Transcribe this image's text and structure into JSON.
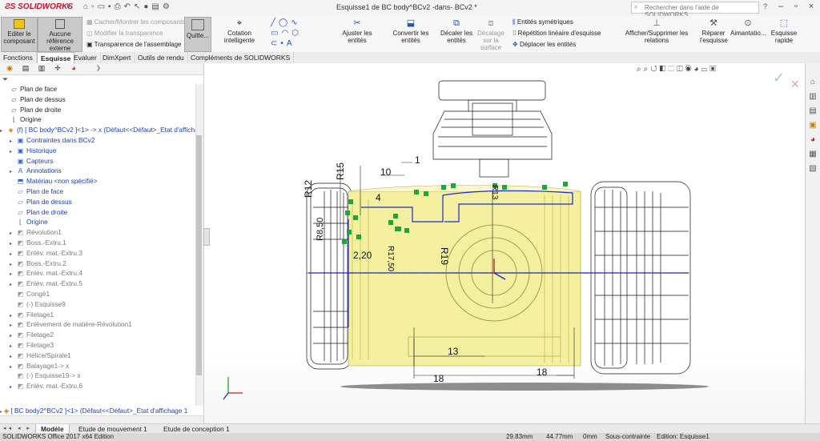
{
  "app": {
    "logo": "SOLIDWORKS",
    "window_title": "Esquisse1 de BC body^BCv2 -dans- BCv2 *",
    "search_placeholder": "Rechercher dans l'aide de SOLIDWORKS",
    "accent_color": "#c8102e"
  },
  "toolbar": {
    "editer_composant": "Editer le composant",
    "aucune_reference": "Aucune référence externe",
    "cacher_montrer": "Cacher/Montrer les composants",
    "modifier_transparence": "Modifier la transparence",
    "transparence_assemblage": "Transparence de l'assemblage",
    "quitter": "Quitte...",
    "cotation": "Cotation intelligente",
    "ajuster": "Ajuster les entités",
    "convertir": "Convertir les entités",
    "decaler": "Décaler les entités",
    "decalage_surface": "Décalage sur la surface",
    "entites_symetriques": "Entités symétriques",
    "repetition_lineaire": "Répétition linéaire d'esquisse",
    "deplacer": "Déplacer les entités",
    "afficher_relations": "Afficher/Supprimer les relations",
    "reparer": "Réparer l'esquisse",
    "aimantation": "Aimantatio...",
    "esquisse_rapide": "Esquisse rapide"
  },
  "command_tabs": [
    "Fonctions",
    "Esquisse",
    "Evaluer",
    "DimXpert",
    "Outils de rendu",
    "Compléments de SOLIDWORKS"
  ],
  "command_tab_selected": "Esquisse",
  "tree": {
    "top_items": [
      "Plan de face",
      "Plan de dessus",
      "Plan de droite",
      "Origine"
    ],
    "component": "(f) [ BC body^BCv2 ]<1> -> x (Défaut<<Défaut>_Etat d'affichag",
    "component_children": [
      {
        "label": "Contraintes dans BCv2",
        "arrow": true
      },
      {
        "label": "Historique",
        "arrow": true
      },
      {
        "label": "Capteurs",
        "arrow": false
      },
      {
        "label": "Annotations",
        "arrow": true
      },
      {
        "label": "Matériau <non spécifié>",
        "arrow": false
      },
      {
        "label": "Plan de face",
        "arrow": false
      },
      {
        "label": "Plan de dessus",
        "arrow": false
      },
      {
        "label": "Plan de droite",
        "arrow": false
      },
      {
        "label": "Origine",
        "arrow": false
      }
    ],
    "features": [
      {
        "label": "Révolution1",
        "arrow": true
      },
      {
        "label": "Boss.-Extru.1",
        "arrow": true
      },
      {
        "label": "Enlév. mat.-Extru.3",
        "arrow": true
      },
      {
        "label": "Boss.-Extru.2",
        "arrow": true
      },
      {
        "label": "Enlév. mat.-Extru.4",
        "arrow": true
      },
      {
        "label": "Enlév. mat.-Extru.5",
        "arrow": true
      },
      {
        "label": "Congé1",
        "arrow": false
      },
      {
        "label": "(-) Esquisse9",
        "arrow": false
      },
      {
        "label": "Filetage1",
        "arrow": true
      },
      {
        "label": "Enlèvement de matière-Révolution1",
        "arrow": true
      },
      {
        "label": "Filetage2",
        "arrow": true
      },
      {
        "label": "Filetage3",
        "arrow": true
      },
      {
        "label": "Hélice/Spirale1",
        "arrow": true
      },
      {
        "label": "Balayage1-> x",
        "arrow": true
      },
      {
        "label": "(-) Esquisse19-> x",
        "arrow": false
      },
      {
        "label": "Enlév. mat.-Extru.6",
        "arrow": true
      }
    ],
    "bottom_item": "[ BC body2^BCv2 ]<1> (Défaut<<Défaut>_Etat d'affichage 1"
  },
  "dimensions": {
    "r12": "R12",
    "r15": "R15",
    "d10": "10",
    "d1": "1",
    "d4": "4",
    "r13": "R13",
    "r8_50": "R8,50",
    "r17_50": "R17,50",
    "r19": "R19",
    "d2_20": "2,20",
    "d13": "13",
    "d18a": "18",
    "d18b": "18"
  },
  "bottom_tabs": [
    "Modèle",
    "Etude de mouvement 1",
    "Etude de conception 1"
  ],
  "bottom_tab_selected": "Modèle",
  "status": {
    "app": "SOLIDWORKS Office 2017 x64 Edition",
    "x": "29.83mm",
    "y": "44.77mm",
    "z": "0mm",
    "constraint": "Sous-contrainte",
    "edition": "Edition: Esquisse1"
  }
}
